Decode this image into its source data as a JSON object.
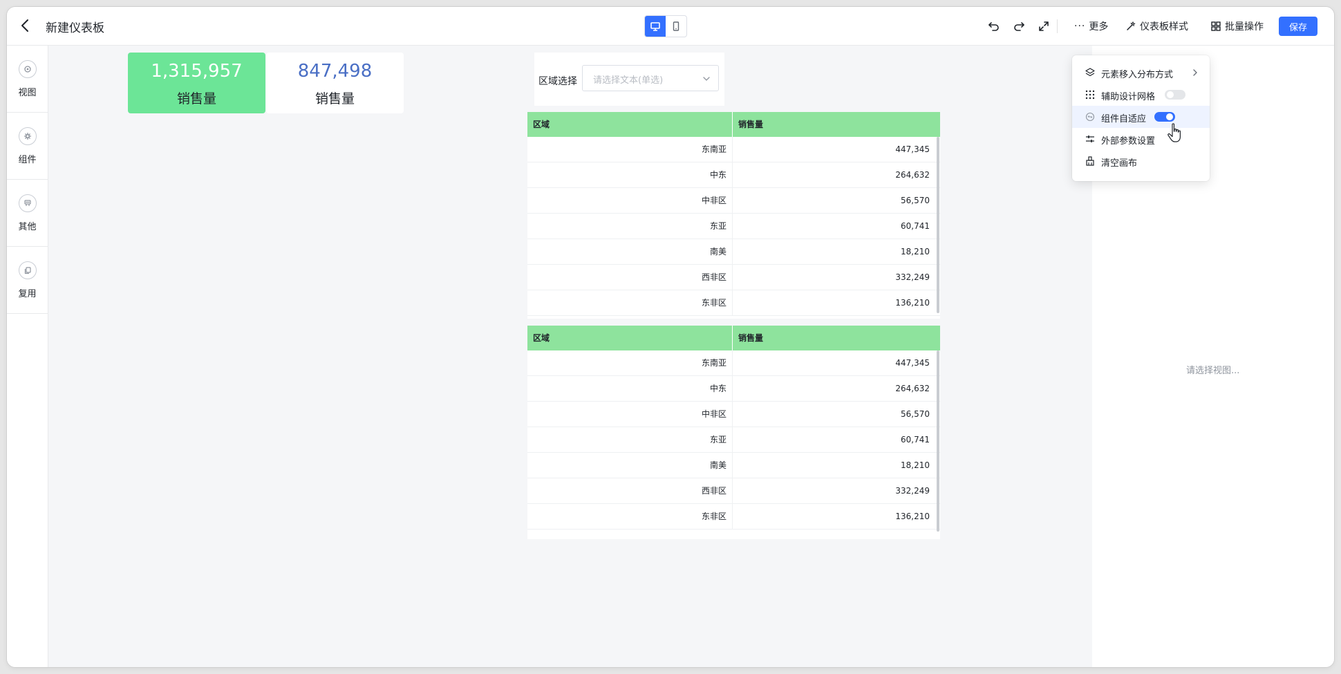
{
  "header": {
    "title": "新建仪表板",
    "more_label": "更多",
    "style_label": "仪表板样式",
    "batch_label": "批量操作",
    "save_label": "保存"
  },
  "sidebar": {
    "items": [
      {
        "label": "视图",
        "icon": "view-icon"
      },
      {
        "label": "组件",
        "icon": "component-icon"
      },
      {
        "label": "其他",
        "icon": "other-icon"
      },
      {
        "label": "复用",
        "icon": "reuse-icon"
      }
    ]
  },
  "kpis": [
    {
      "value": "1,315,957",
      "label": "销售量",
      "bg": "#6ce597",
      "color": "#ffffff"
    },
    {
      "value": "847,498",
      "label": "销售量",
      "bg": "#ffffff",
      "color": "#4a6fc5"
    }
  ],
  "filter": {
    "label": "区域选择",
    "placeholder": "请选择文本(单选)"
  },
  "tables": [
    {
      "headers": [
        "区域",
        "销售量"
      ],
      "rows": [
        [
          "东南亚",
          "447,345"
        ],
        [
          "中东",
          "264,632"
        ],
        [
          "中非区",
          "56,570"
        ],
        [
          "东亚",
          "60,741"
        ],
        [
          "南美",
          "18,210"
        ],
        [
          "西非区",
          "332,249"
        ],
        [
          "东非区",
          "136,210"
        ]
      ]
    },
    {
      "headers": [
        "区域",
        "销售量"
      ],
      "rows": [
        [
          "东南亚",
          "447,345"
        ],
        [
          "中东",
          "264,632"
        ],
        [
          "中非区",
          "56,570"
        ],
        [
          "东亚",
          "60,741"
        ],
        [
          "南美",
          "18,210"
        ],
        [
          "西非区",
          "332,249"
        ],
        [
          "东非区",
          "136,210"
        ]
      ]
    }
  ],
  "right_panel": {
    "placeholder": "请选择视图..."
  },
  "menu": {
    "items": [
      {
        "label": "元素移入分布方式",
        "icon": "layers-icon",
        "type": "submenu"
      },
      {
        "label": "辅助设计网格",
        "icon": "grid-icon",
        "type": "toggle",
        "on": false
      },
      {
        "label": "组件自适应",
        "icon": "adaptive-icon",
        "type": "toggle",
        "on": true
      },
      {
        "label": "外部参数设置",
        "icon": "sliders-icon",
        "type": "action"
      },
      {
        "label": "清空画布",
        "icon": "clear-icon",
        "type": "action"
      }
    ]
  },
  "colors": {
    "accent": "#3370ff",
    "table_header": "#8ee39d",
    "kpi_green": "#6ce597"
  }
}
